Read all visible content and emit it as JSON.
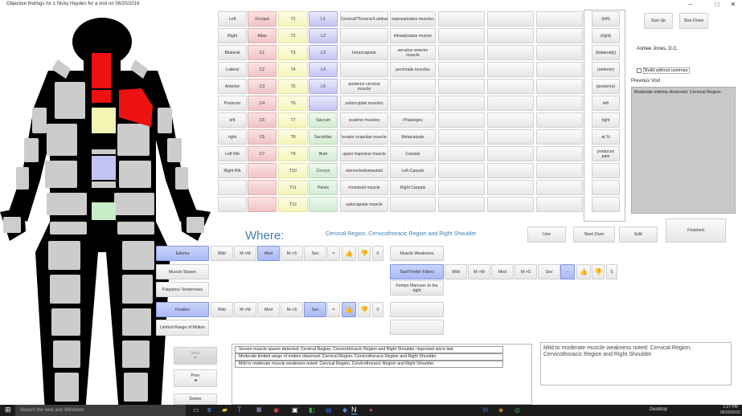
{
  "window": {
    "title": "Objective findings for 1 Nicky Hayden for a visit on 06/20/2016"
  },
  "grid": {
    "col1": [
      "Left",
      "Right",
      "Bilateral",
      "Lateral",
      "Anterior",
      "Posterior",
      "left",
      "right",
      "Left Rib",
      "Right Rib",
      "",
      ""
    ],
    "col2": [
      "Occiput",
      "Atlas",
      "C1",
      "C2",
      "C3",
      "C4",
      "C5",
      "C6",
      "C7",
      "",
      "",
      ""
    ],
    "col3": [
      "T1",
      "T2",
      "T3",
      "T4",
      "T5",
      "T6",
      "T7",
      "T8",
      "T9",
      "T10",
      "T11",
      "T12"
    ],
    "col4": [
      "L1",
      "L2",
      "L3",
      "L4",
      "L5",
      "",
      "Sacrum",
      "Sacroiliac",
      "Ilium",
      "Coccyx",
      "Pelvis",
      ""
    ],
    "col5": [
      "Cervical/Thoracic/Lumbar",
      "",
      "Intrascapular",
      "",
      "posterior cervical muscle",
      "suboccipital muscles",
      "scalene muscles",
      "levator scapulae muscle",
      "upper trapezius muscle",
      "sternocleidomastoid",
      "rhomboid muscle",
      "subscapular muscle"
    ],
    "col6": [
      "supraspinatus muscles",
      "infraspinatus muscle",
      "serratus anterior muscle",
      "pectoralis muscles",
      "",
      "",
      "Phalanges",
      "Metacarpals",
      "Carpals",
      "Left Carpals",
      "Right Carpals",
      ""
    ],
    "right_col": [
      "(left)",
      "(right)",
      "(bilaterally)",
      "(anterior)",
      "(posterior)",
      "left",
      "right",
      "at   %",
      "produces pain",
      "",
      "",
      ""
    ]
  },
  "right_panel": {
    "size_up": "Size Up",
    "size_down": "Size Down",
    "doctor": "Ashlee Jones, D.C.",
    "build_label": "Build without commas",
    "prev_label": "Previous Visit",
    "prev_text": "Moderate edema observed: Cervical Region."
  },
  "where": {
    "label": "Where:",
    "value": "Cervical Region, Cervicothoracic Region and Right Shoulder"
  },
  "actions": {
    "use": "Use",
    "start_over": "Start Over",
    "edit": "Edit",
    "finished": "Finished"
  },
  "findings_left": [
    {
      "label": "Edema",
      "selected": true
    },
    {
      "label": "Muscle Spasm",
      "selected": false
    },
    {
      "label": "Palpatory Tenderness",
      "selected": false
    },
    {
      "label": "Fixation",
      "selected": true
    },
    {
      "label": "Limited Range of Motion",
      "selected": false
    }
  ],
  "findings_right": [
    {
      "label": "Muscle Weakness",
      "selected": false
    },
    {
      "label": "Taut/Tender Fibers",
      "selected": true
    },
    {
      "label": "Kemps Manuver to the right",
      "selected": false
    },
    {
      "label": "",
      "selected": false
    },
    {
      "label": "",
      "selected": false
    }
  ],
  "severity": {
    "labels": [
      "Mild",
      "M->M",
      "Mod",
      "M->S",
      "Sev"
    ],
    "equal": "=",
    "minus": "-",
    "count": "0",
    "thumbs_up_icon": "thumbs-up-icon",
    "thumbs_down_icon": "thumbs-down-icon"
  },
  "nav": {
    "next": "Next",
    "prev": "Prev",
    "delete": "Delete"
  },
  "notes": [
    "Severe muscle spasm detected: Cervical Region, Cervicothoracic Region and Right Shoulder, improved since last",
    "Moderate limited range of motion observed: Cervical Region, Cervicothoracic Region and Right Shoulder.",
    "Mild to moderate muscle weakness noted: Cervical Region, Cervicothoracic Region and Right Shoulder."
  ],
  "summary": "Mild to moderate muscle weakness noted: Cervical Region, Cervicothoracic Region and Right Shoulder.",
  "taskbar": {
    "search_placeholder": "Search the web and Windows",
    "desktop": "Desktop",
    "time": "1:27 PM",
    "date": "06/20/2016"
  },
  "colors": {
    "selected": "#aab9f2",
    "cervical": "#ee1111",
    "thoracic": "#f3f3a8",
    "lumbar": "#c4c4f3",
    "sacral": "#c8ecc8",
    "taskbar": "#1c1c1c"
  }
}
